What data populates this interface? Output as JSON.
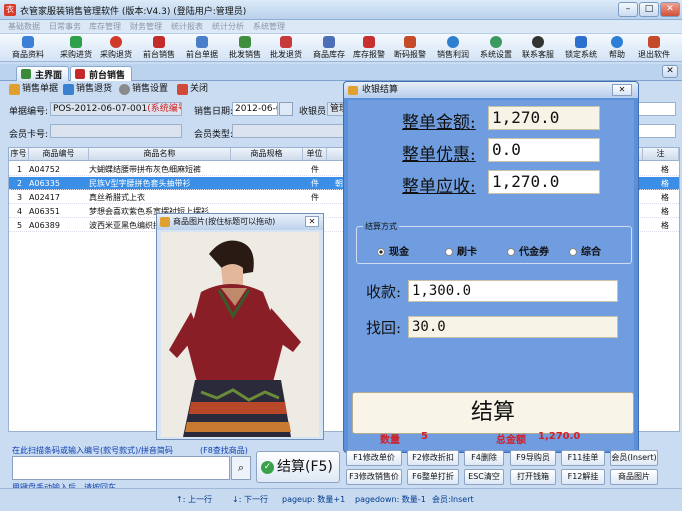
{
  "window": {
    "title": "衣管家服装销售管理软件 (版本:V4.3) (登陆用户:管理员)",
    "app_icon_text": "衣"
  },
  "menu": [
    "基础数据",
    "日常事务",
    "库存管理",
    "财务管理",
    "统计报表",
    "统计分析",
    "系统管理"
  ],
  "toolbar": [
    {
      "label": "商品资料",
      "color": "#3c7fd6"
    },
    {
      "label": "采购进货",
      "color": "#2ea04a"
    },
    {
      "label": "采购退货",
      "color": "#d03a2a"
    },
    {
      "label": "前台销售",
      "color": "#c52a2a"
    },
    {
      "label": "前台单据",
      "color": "#4a7ec8"
    },
    {
      "label": "批发销售",
      "color": "#3f8e3f"
    },
    {
      "label": "批发退货",
      "color": "#c83a3a"
    },
    {
      "label": "商品库存",
      "color": "#4d6fb8"
    },
    {
      "label": "库存报警",
      "color": "#c83030"
    },
    {
      "label": "断码报警",
      "color": "#c44a2a"
    },
    {
      "label": "销售利润",
      "color": "#2f7fcf"
    },
    {
      "label": "系统设置",
      "color": "#3a9a60"
    },
    {
      "label": "联系客服",
      "color": "#333"
    },
    {
      "label": "锁定系统",
      "color": "#2c6fcf"
    },
    {
      "label": "帮助",
      "color": "#2c7fd6"
    },
    {
      "label": "退出软件",
      "color": "#c44a2a"
    }
  ],
  "tabs": [
    {
      "label": "主界面"
    },
    {
      "label": "前台销售"
    }
  ],
  "subbar": [
    "销售单据",
    "销售退货",
    "销售设置",
    "关闭"
  ],
  "form": {
    "doc_no_label": "单据编号:",
    "doc_no": "POS-2012-06-07-001",
    "doc_no_note": "(系统编号)",
    "date_label": "销售日期:",
    "date": "2012-06-07",
    "cashier_label": "收银员:",
    "cashier": "管理",
    "member_card_label": "会员卡号:",
    "member_type_label": "会员类型:"
  },
  "grid": {
    "columns": [
      "序号",
      "商品编号",
      "商品名称",
      "商品规格",
      "单位"
    ],
    "right_col": "注",
    "rows": [
      {
        "no": "1",
        "code": "A04752",
        "name": "大蝴蝶结腰带拼布灰色细麻短裤",
        "unit": "件",
        "extra": "",
        "tail": "格"
      },
      {
        "no": "2",
        "code": "A06335",
        "name": "民族V型字腰拼色套头抽带衫",
        "unit": "件",
        "extra": "朝",
        "tail": "格"
      },
      {
        "no": "3",
        "code": "A02417",
        "name": "真丝希腊式上衣",
        "unit": "件",
        "extra": "",
        "tail": "格"
      },
      {
        "no": "4",
        "code": "A06351",
        "name": "梦想会喜欢紫色系宽摆衬短上摆衫",
        "unit": "",
        "extra": "",
        "tail": "格"
      },
      {
        "no": "5",
        "code": "A06389",
        "name": "波西米亚黑色编织拼",
        "unit": "",
        "extra": "",
        "tail": "格"
      }
    ]
  },
  "image_window": {
    "title": "商品图片(按住标题可以拖动)"
  },
  "payment": {
    "title": "收银结算",
    "total_label": "整单金额:",
    "total": "1,270.0",
    "discount_label": "整单优惠:",
    "discount": "0.0",
    "due_label": "整单应收:",
    "due": "1,270.0",
    "method_title": "结算方式",
    "methods": [
      {
        "label": "现金",
        "selected": true
      },
      {
        "label": "刷卡",
        "selected": false
      },
      {
        "label": "代金券",
        "selected": false
      },
      {
        "label": "综合",
        "selected": false
      }
    ],
    "received_label": "收款:",
    "received": "1,300.0",
    "change_label": "找回:",
    "change": "30.0",
    "checkout_label": "结算"
  },
  "bottom": {
    "scan_hint": "在此扫描条码或输入编号(款号款式)/拼音简码",
    "find_hint": "(F8查找商品)",
    "manual_hint": "用键盘手动输入后，请按回车",
    "qty_label": "数量",
    "qty": "5",
    "total_label": "总金额",
    "total": "1,270.0",
    "checkout_button": "结算(F5)",
    "fkeys": [
      [
        "F1修改单价",
        "F2修改折扣",
        "F4删除",
        "F9导购员",
        "F11挂单",
        "会员(Insert)"
      ],
      [
        "F3修改销售价",
        "F6整单打折",
        "ESC清空",
        "打开钱箱",
        "F12解挂",
        "商品图片"
      ]
    ]
  },
  "status": {
    "up": "↑: 上一行",
    "down": "↓: 下一行",
    "pageup": "pageup: 数量+1",
    "pagedown": "pagedown: 数量-1",
    "member": "会员:Insert"
  }
}
